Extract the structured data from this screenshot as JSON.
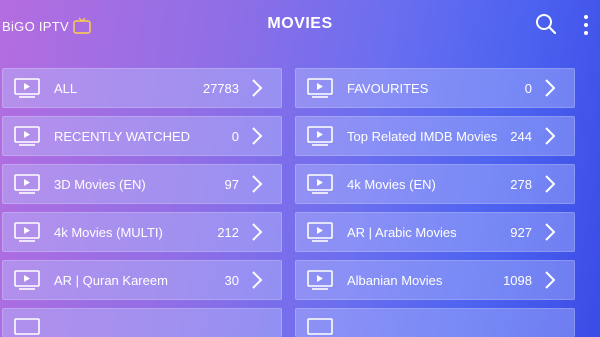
{
  "app": {
    "brand": "BiGO IPTV",
    "brand_badge": "iptv"
  },
  "header": {
    "title": "MOVIES"
  },
  "icons": {
    "search": "search-icon",
    "menu": "more-vertical-icon",
    "play": "tv-play-icon",
    "chevron": "chevron-right-icon"
  },
  "categories": [
    {
      "label": "ALL",
      "count": "27783"
    },
    {
      "label": "FAVOURITES",
      "count": "0"
    },
    {
      "label": "RECENTLY WATCHED",
      "count": "0"
    },
    {
      "label": "Top Related IMDB Movies",
      "count": "244"
    },
    {
      "label": "3D Movies (EN)",
      "count": "97"
    },
    {
      "label": "4k Movies (EN)",
      "count": "278"
    },
    {
      "label": "4k Movies (MULTI)",
      "count": "212"
    },
    {
      "label": "AR | Arabic Movies",
      "count": "927"
    },
    {
      "label": "AR | Quran Kareem",
      "count": "30"
    },
    {
      "label": "Albanian Movies",
      "count": "1098"
    }
  ]
}
